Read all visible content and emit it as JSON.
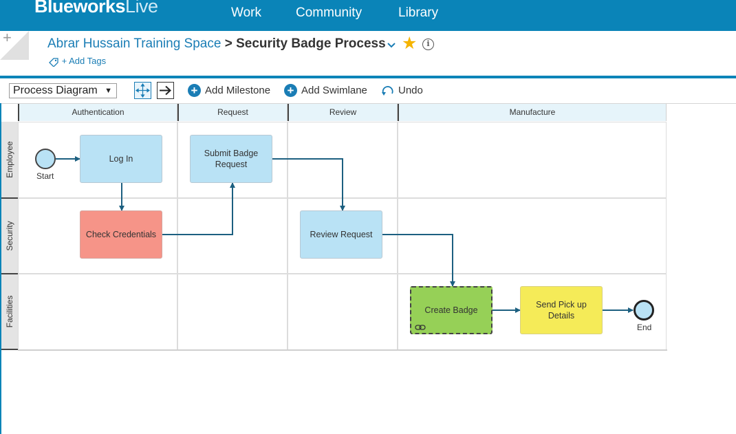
{
  "app": {
    "logo_bold": "Blueworks",
    "logo_light": "Live",
    "nav": [
      "Work",
      "Community",
      "Library"
    ]
  },
  "header": {
    "space_name": "Abrar Hussain Training Space",
    "separator": ">",
    "process_name": "Security Badge Process",
    "add_tags": "+ Add Tags",
    "plus": "+",
    "info_glyph": "i"
  },
  "toolbar": {
    "view_select": "Process Diagram",
    "add_milestone": "Add Milestone",
    "add_swimlane": "Add Swimlane",
    "undo": "Undo"
  },
  "diagram": {
    "milestones": [
      "Authentication",
      "Request",
      "Review",
      "Manufacture"
    ],
    "swimlanes": [
      "Employee",
      "Security",
      "Facilities"
    ],
    "start_label": "Start",
    "end_label": "End",
    "tasks": [
      {
        "label": "Log In",
        "lane": "Employee",
        "milestone": "Authentication",
        "color": "#b9e2f5"
      },
      {
        "label": "Submit Badge Request",
        "lane": "Employee",
        "milestone": "Request",
        "color": "#b9e2f5"
      },
      {
        "label": "Check Credentials",
        "lane": "Security",
        "milestone": "Authentication",
        "color": "#f69488"
      },
      {
        "label": "Review Request",
        "lane": "Security",
        "milestone": "Review",
        "color": "#b9e2f5"
      },
      {
        "label": "Create Badge",
        "lane": "Facilities",
        "milestone": "Manufacture",
        "color": "#96d057"
      },
      {
        "label": "Send Pick up Details",
        "lane": "Facilities",
        "milestone": "Manufacture",
        "color": "#f5eb58"
      }
    ]
  },
  "colors": {
    "brand": "#0a84b8",
    "link": "#1a7db5",
    "star": "#f5b400",
    "flow": "#1c5f80"
  }
}
